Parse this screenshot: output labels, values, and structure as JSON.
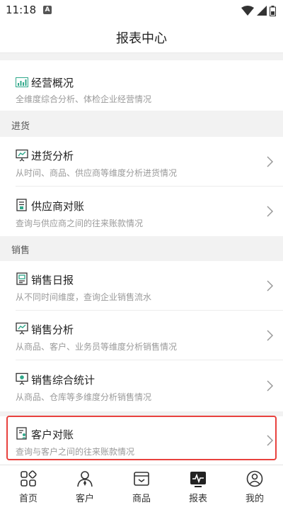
{
  "status": {
    "time": "11:18",
    "notif_badge": "A"
  },
  "header": {
    "title": "报表中心"
  },
  "overview": {
    "title": "经营概况",
    "desc": "全维度综合分析、体检企业经营情况"
  },
  "sections": {
    "purchase": {
      "label": "进货",
      "items": [
        {
          "title": "进货分析",
          "desc": "从时间、商品、供应商等维度分析进货情况"
        },
        {
          "title": "供应商对账",
          "desc": "查询与供应商之间的往来账款情况"
        }
      ]
    },
    "sales": {
      "label": "销售",
      "items": [
        {
          "title": "销售日报",
          "desc": "从不同时间维度，查询企业销售流水"
        },
        {
          "title": "销售分析",
          "desc": "从商品、客户、业务员等维度分析销售情况"
        },
        {
          "title": "销售综合统计",
          "desc": "从商品、仓库等多维度分析销售情况"
        },
        {
          "title": "客户对账",
          "desc": "查询与客户之间的往来账款情况"
        }
      ]
    }
  },
  "tabs": [
    {
      "label": "首页",
      "icon": "grid-icon"
    },
    {
      "label": "客户",
      "icon": "person-icon"
    },
    {
      "label": "商品",
      "icon": "box-icon"
    },
    {
      "label": "报表",
      "icon": "report-icon",
      "active": true
    },
    {
      "label": "我的",
      "icon": "profile-icon"
    }
  ],
  "colors": {
    "accent": "#2fa88a",
    "highlight": "#e8413e"
  }
}
